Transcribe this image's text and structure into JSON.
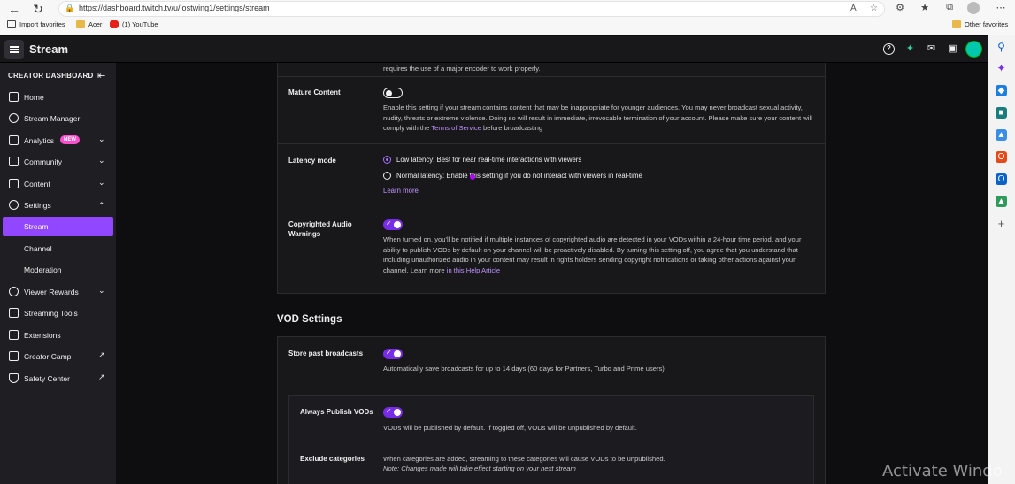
{
  "browser": {
    "url": "https://dashboard.twitch.tv/u/lostwing1/settings/stream",
    "bookmarks": [
      "Import favorites",
      "Acer",
      "(1) YouTube"
    ],
    "other_favorites": "Other favorites"
  },
  "header": {
    "title": "Stream"
  },
  "sidebar": {
    "heading": "CREATOR DASHBOARD",
    "items": [
      {
        "label": "Home"
      },
      {
        "label": "Stream Manager"
      },
      {
        "label": "Analytics",
        "badge": "NEW"
      },
      {
        "label": "Community"
      },
      {
        "label": "Content"
      },
      {
        "label": "Settings"
      },
      {
        "label": "Stream"
      },
      {
        "label": "Channel"
      },
      {
        "label": "Moderation"
      },
      {
        "label": "Viewer Rewards"
      },
      {
        "label": "Streaming Tools"
      },
      {
        "label": "Extensions"
      },
      {
        "label": "Creator Camp"
      },
      {
        "label": "Safety Center"
      }
    ]
  },
  "settings": {
    "top_text": "requires the use of a major encoder to work properly.",
    "mature": {
      "label": "Mature Content",
      "toggle": "off",
      "text1": "Enable this setting if your stream contains content that may be inappropriate for younger audiences. You may never broadcast sexual activity, nudity, threats or extreme violence. Doing so will result in immediate, irrevocable termination of your account. Please make sure your content will comply with the ",
      "link": "Terms of Service",
      "text2": " before broadcasting"
    },
    "latency": {
      "label": "Latency mode",
      "option_low": "Low latency: Best for near real-time interactions with viewers",
      "option_normal": "Normal latency: Enable this setting if you do not interact with viewers in real-time",
      "selected": "low",
      "learn_more": "Learn more"
    },
    "copyright": {
      "label": "Copyrighted Audio Warnings",
      "toggle": "on",
      "text": "When turned on, you'll be notified if multiple instances of copyrighted audio are detected in your VODs within a 24-hour time period, and your ability to publish VODs by default on your channel will be proactively disabled. By turning this setting off, you agree that you understand that including unauthorized audio in your content may result in rights holders sending copyright notifications or taking other actions against your channel. Learn more ",
      "link": "in this Help Article"
    }
  },
  "vod": {
    "heading": "VOD Settings",
    "store": {
      "label": "Store past broadcasts",
      "toggle": "on",
      "text": "Automatically save broadcasts for up to 14 days (60 days for Partners, Turbo and Prime users)"
    },
    "always_publish": {
      "label": "Always Publish VODs",
      "toggle": "on",
      "text": "VODs will be published by default. If toggled off, VODs will be unpublished by default."
    },
    "exclude": {
      "label": "Exclude categories",
      "text": "When categories are added, streaming to these categories will cause VODs to be unpublished.",
      "note": "Note: Changes made will take effect starting on your next stream"
    }
  },
  "watermark": "Activate Windo",
  "colors": {
    "accent": "#9147ff",
    "link": "#bf94ff",
    "badge": "#ff4fcf"
  }
}
